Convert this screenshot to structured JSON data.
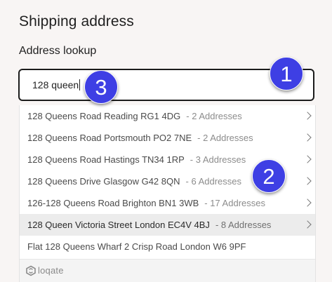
{
  "page": {
    "title": "Shipping address",
    "field_label": "Address lookup"
  },
  "search": {
    "value": "128 queen"
  },
  "suggestions": [
    {
      "address": "128 Queens Road Reading RG1 4DG",
      "count": "- 2 Addresses",
      "has_chevron": true,
      "highlighted": false
    },
    {
      "address": "128 Queens Road Portsmouth PO2 7NE",
      "count": "- 2 Addresses",
      "has_chevron": true,
      "highlighted": false
    },
    {
      "address": "128 Queens Road Hastings TN34 1RP",
      "count": "- 3 Addresses",
      "has_chevron": true,
      "highlighted": false
    },
    {
      "address": "128 Queens Drive Glasgow G42 8QN",
      "count": "- 6 Addresses",
      "has_chevron": true,
      "highlighted": false
    },
    {
      "address": "126-128 Queens Road Brighton BN1 3WB",
      "count": "- 17 Addresses",
      "has_chevron": true,
      "highlighted": false
    },
    {
      "address": "128 Queen Victoria Street London EC4V 4BJ",
      "count": "- 8 Addresses",
      "has_chevron": true,
      "highlighted": true
    },
    {
      "address": "Flat 128 Queens Wharf 2 Crisp Road London W6 9PF",
      "count": "",
      "has_chevron": false,
      "highlighted": false
    }
  ],
  "footer": {
    "brand": "loqate",
    "icon": "loqate-logo-icon"
  },
  "annotations": [
    {
      "label": "1"
    },
    {
      "label": "2"
    },
    {
      "label": "3"
    }
  ],
  "colors": {
    "badge": "#3e3fe4",
    "highlight_row": "#ececec",
    "page_background": "#f8f5f4"
  }
}
